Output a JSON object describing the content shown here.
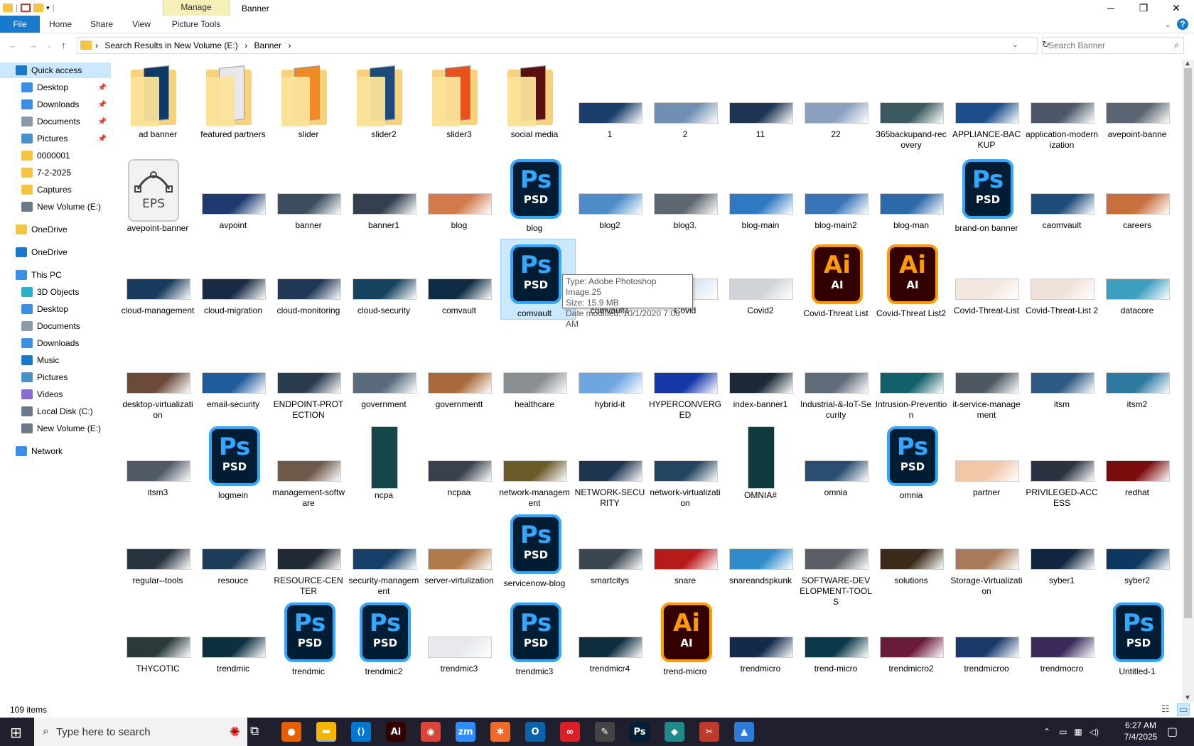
{
  "window": {
    "title": "Banner",
    "context_tab_label": "Manage",
    "minimize": "─",
    "restore": "❐",
    "close": "✕"
  },
  "ribbon": {
    "tabs": [
      "File",
      "Home",
      "Share",
      "View",
      "Picture Tools"
    ],
    "help": "?"
  },
  "address": {
    "crumbs": [
      "Search Results in New Volume (E:)",
      "Banner"
    ],
    "search_placeholder": "Search Banner"
  },
  "sidebar": {
    "items": [
      {
        "label": "Quick access",
        "icon": "star-icon",
        "pinned": false,
        "selected": true
      },
      {
        "label": "Desktop",
        "icon": "desktop-icon",
        "pinned": true
      },
      {
        "label": "Downloads",
        "icon": "download-icon",
        "pinned": true
      },
      {
        "label": "Documents",
        "icon": "documents-icon",
        "pinned": true
      },
      {
        "label": "Pictures",
        "icon": "pictures-icon",
        "pinned": true
      },
      {
        "label": "0000001",
        "icon": "folder-icon",
        "pinned": false
      },
      {
        "label": "7-2-2025",
        "icon": "folder-icon",
        "pinned": false
      },
      {
        "label": "Captures",
        "icon": "folder-icon",
        "pinned": false
      },
      {
        "label": "New Volume (E:)",
        "icon": "drive-icon",
        "pinned": false
      },
      {
        "label": "OneDrive",
        "icon": "folder-icon",
        "pinned": false
      },
      {
        "label": "OneDrive",
        "icon": "cloud-icon",
        "pinned": false
      },
      {
        "label": "This PC",
        "icon": "pc-icon",
        "pinned": false
      },
      {
        "label": "3D Objects",
        "icon": "cube-icon",
        "pinned": false
      },
      {
        "label": "Desktop",
        "icon": "desktop-icon",
        "pinned": false
      },
      {
        "label": "Documents",
        "icon": "documents-icon",
        "pinned": false
      },
      {
        "label": "Downloads",
        "icon": "download-icon",
        "pinned": false
      },
      {
        "label": "Music",
        "icon": "music-icon",
        "pinned": false
      },
      {
        "label": "Pictures",
        "icon": "pictures-icon",
        "pinned": false
      },
      {
        "label": "Videos",
        "icon": "video-icon",
        "pinned": false
      },
      {
        "label": "Local Disk (C:)",
        "icon": "drive-icon",
        "pinned": false
      },
      {
        "label": "New Volume (E:)",
        "icon": "drive-icon",
        "pinned": false
      },
      {
        "label": "Network",
        "icon": "network-icon",
        "pinned": false
      }
    ],
    "pin_glyph": "📌"
  },
  "files": [
    [
      {
        "name": "ad banner",
        "kind": "folder",
        "color": "#0d3b66"
      },
      {
        "name": "featured partners",
        "kind": "folder",
        "color": "#e8e8e8"
      },
      {
        "name": "slider",
        "kind": "folder",
        "color": "#f08a24"
      },
      {
        "name": "slider2",
        "kind": "folder",
        "color": "#1c4a7a"
      },
      {
        "name": "slider3",
        "kind": "folder",
        "color": "#e8501c"
      },
      {
        "name": "social media",
        "kind": "folder",
        "color": "#5a1010"
      },
      {
        "name": "1",
        "kind": "img",
        "color": "#1a3f6b"
      },
      {
        "name": "2",
        "kind": "img",
        "color": "#6f8fb3"
      },
      {
        "name": "11",
        "kind": "img",
        "color": "#1e3554"
      },
      {
        "name": "22",
        "kind": "img",
        "color": "#8aa0bf"
      },
      {
        "name": "365backupand-recovery",
        "kind": "img",
        "color": "#3a5a5f"
      },
      {
        "name": "APPLIANCE-BACKUP",
        "kind": "img",
        "color": "#1b4e8a"
      },
      {
        "name": "application-modernization",
        "kind": "img",
        "color": "#4c5868"
      },
      {
        "name": "avepoint-banne",
        "kind": "img",
        "color": "#5b6572"
      }
    ],
    [
      {
        "name": "avepoint-banner",
        "kind": "eps"
      },
      {
        "name": "avpoint",
        "kind": "img",
        "color": "#1e3a70"
      },
      {
        "name": "banner",
        "kind": "img",
        "color": "#3b4d5e"
      },
      {
        "name": "banner1",
        "kind": "img",
        "color": "#34404e"
      },
      {
        "name": "blog",
        "kind": "img",
        "color": "#d17b4c"
      },
      {
        "name": "blog",
        "kind": "ps"
      },
      {
        "name": "blog2",
        "kind": "img",
        "color": "#4d8cc9"
      },
      {
        "name": "blog3.",
        "kind": "img",
        "color": "#5d6770"
      },
      {
        "name": "blog-main",
        "kind": "img",
        "color": "#2f78c2"
      },
      {
        "name": "blog-main2",
        "kind": "img",
        "color": "#3773b6"
      },
      {
        "name": "blog-man",
        "kind": "img",
        "color": "#2d6aa8"
      },
      {
        "name": "brand-on banner",
        "kind": "ps"
      },
      {
        "name": "caomvault",
        "kind": "img",
        "color": "#1e4d7a"
      },
      {
        "name": "careers",
        "kind": "img",
        "color": "#c8703d"
      }
    ],
    [
      {
        "name": "cloud-management",
        "kind": "img",
        "color": "#173a5e"
      },
      {
        "name": "cloud-migration",
        "kind": "img",
        "color": "#1a2c45"
      },
      {
        "name": "cloud-monitoring",
        "kind": "img",
        "color": "#203855"
      },
      {
        "name": "cloud-security",
        "kind": "img",
        "color": "#14425f"
      },
      {
        "name": "comvault",
        "kind": "img",
        "color": "#0e2d44"
      },
      {
        "name": "comvault",
        "kind": "ps",
        "selected": true
      },
      {
        "name": "comvault1",
        "kind": "img",
        "color": "#4a6580"
      },
      {
        "name": "Covid",
        "kind": "img",
        "color": "#dbe5f2"
      },
      {
        "name": "Covid2",
        "kind": "img",
        "color": "#d0d4d8"
      },
      {
        "name": "Covid-Threat List",
        "kind": "ai"
      },
      {
        "name": "Covid-Threat List2",
        "kind": "ai"
      },
      {
        "name": "Covid-Threat-List",
        "kind": "img",
        "color": "#f2e6df"
      },
      {
        "name": "Covid-Threat-List 2",
        "kind": "img",
        "color": "#f0e2d9"
      },
      {
        "name": "datacore",
        "kind": "img",
        "color": "#3d9fbf"
      }
    ],
    [
      {
        "name": "desktop-virtualization",
        "kind": "img",
        "color": "#6b4a3a"
      },
      {
        "name": "email-security",
        "kind": "img",
        "color": "#1f5a9a"
      },
      {
        "name": "ENDPOINT-PROTECTION",
        "kind": "img",
        "color": "#2a3d4f"
      },
      {
        "name": "government",
        "kind": "img",
        "color": "#596b7d"
      },
      {
        "name": "governmentt",
        "kind": "img",
        "color": "#a86a3a"
      },
      {
        "name": "healthcare",
        "kind": "img",
        "color": "#8a8f94"
      },
      {
        "name": "hybrid-it",
        "kind": "img",
        "color": "#6fa6e0"
      },
      {
        "name": "HYPERCONVERGED",
        "kind": "img",
        "color": "#1438a8"
      },
      {
        "name": "index-banner1",
        "kind": "img",
        "color": "#1c2a38"
      },
      {
        "name": "Industrial-&-IoT-Security",
        "kind": "img",
        "color": "#5f6b78"
      },
      {
        "name": "Intrusion-Prevention",
        "kind": "img",
        "color": "#12606a"
      },
      {
        "name": "it-service-management",
        "kind": "img",
        "color": "#4c5760"
      },
      {
        "name": "itsm",
        "kind": "img",
        "color": "#2c5a82"
      },
      {
        "name": "itsm2",
        "kind": "img",
        "color": "#2e7aa0"
      }
    ],
    [
      {
        "name": "itsm3",
        "kind": "img",
        "color": "#505a66"
      },
      {
        "name": "logmein",
        "kind": "ps"
      },
      {
        "name": "management-software",
        "kind": "img",
        "color": "#6e5a4a"
      },
      {
        "name": "ncpa",
        "kind": "tall",
        "color": "#15464a"
      },
      {
        "name": "ncpaa",
        "kind": "img",
        "color": "#39424c"
      },
      {
        "name": "network-management",
        "kind": "img",
        "color": "#6a5a2a"
      },
      {
        "name": "NETWORK-SECURITY",
        "kind": "img",
        "color": "#1e3550"
      },
      {
        "name": "network-virtualization",
        "kind": "img",
        "color": "#244460"
      },
      {
        "name": "OMNIA#",
        "kind": "tall",
        "color": "#113a3e"
      },
      {
        "name": "omnia",
        "kind": "img",
        "color": "#2a4d70"
      },
      {
        "name": "omnia",
        "kind": "ps"
      },
      {
        "name": "partner",
        "kind": "img",
        "color": "#f1c7a8"
      },
      {
        "name": "PRIVILEGED-ACCESS",
        "kind": "img",
        "color": "#2b3340"
      },
      {
        "name": "redhat",
        "kind": "img",
        "color": "#7a0c0c"
      }
    ],
    [
      {
        "name": "regular--tools",
        "kind": "img",
        "color": "#27333f"
      },
      {
        "name": "resouce",
        "kind": "img",
        "color": "#1d3b5a"
      },
      {
        "name": "RESOURCE-CENTER",
        "kind": "img",
        "color": "#202a35"
      },
      {
        "name": "security-management",
        "kind": "img",
        "color": "#16406a"
      },
      {
        "name": "server-virtulization",
        "kind": "img",
        "color": "#b07a4a"
      },
      {
        "name": "servicenow-blog",
        "kind": "ps"
      },
      {
        "name": "smartcitys",
        "kind": "img",
        "color": "#3a4650"
      },
      {
        "name": "snare",
        "kind": "img",
        "color": "#b81a1a"
      },
      {
        "name": "snareandspkunk",
        "kind": "img",
        "color": "#2e8ac9"
      },
      {
        "name": "SOFTWARE-DEVELOPMENT-TOOLS",
        "kind": "img",
        "color": "#5a5f66"
      },
      {
        "name": "solutions",
        "kind": "img",
        "color": "#3a2a1a"
      },
      {
        "name": "Storage-Virtualization",
        "kind": "img",
        "color": "#a87a5a"
      },
      {
        "name": "syber1",
        "kind": "img",
        "color": "#0f2540"
      },
      {
        "name": "syber2",
        "kind": "img",
        "color": "#0e3860"
      }
    ],
    [
      {
        "name": "THYCOTIC",
        "kind": "img",
        "color": "#2a3a3a"
      },
      {
        "name": "trendmic",
        "kind": "img",
        "color": "#0c3040"
      },
      {
        "name": "trendmic",
        "kind": "ps"
      },
      {
        "name": "trendmic2",
        "kind": "ps"
      },
      {
        "name": "trendmic3",
        "kind": "img",
        "color": "#e6eaee"
      },
      {
        "name": "trendmic3",
        "kind": "ps"
      },
      {
        "name": "trendmicr4",
        "kind": "img",
        "color": "#0d2e3e"
      },
      {
        "name": "trend-micro",
        "kind": "ai"
      },
      {
        "name": "trendmicro",
        "kind": "img",
        "color": "#132a4a"
      },
      {
        "name": "trend-micro",
        "kind": "img",
        "color": "#0a3a4a"
      },
      {
        "name": "trendmicro2",
        "kind": "img",
        "color": "#6a1a3a"
      },
      {
        "name": "trendmicroo",
        "kind": "img",
        "color": "#1a3a6a"
      },
      {
        "name": "trendmocro",
        "kind": "img",
        "color": "#3a2a5a"
      },
      {
        "name": "Untitled-1",
        "kind": "ps"
      }
    ]
  ],
  "icons": {
    "ps_big": "Ps",
    "ps_small": "PSD",
    "ai_big": "Ai",
    "ai_small": "AI",
    "eps_label": "EPS"
  },
  "tooltip": {
    "line1": "Type: Adobe Photoshop Image.25",
    "line2": "Size: 15.9 MB",
    "line3": "Date modified: 10/1/2020 7:08 AM"
  },
  "status": {
    "count": "109 items"
  },
  "taskbar": {
    "search_placeholder": "Type here to search",
    "apps": [
      {
        "icon": "firefox-icon",
        "glyph": "●",
        "color": "#e66000"
      },
      {
        "icon": "file-explorer-icon",
        "glyph": "▬",
        "color": "#f4b400",
        "active": true
      },
      {
        "icon": "vscode-icon",
        "glyph": "⟨⟩",
        "color": "#0078d4"
      },
      {
        "icon": "illustrator-icon",
        "glyph": "Ai",
        "color": "#330000"
      },
      {
        "icon": "chrome-icon",
        "glyph": "◉",
        "color": "#db4437"
      },
      {
        "icon": "zoom-icon",
        "glyph": "zm",
        "color": "#2d8cff"
      },
      {
        "icon": "postman-icon",
        "glyph": "✱",
        "color": "#f06a2a"
      },
      {
        "icon": "outlook-icon",
        "glyph": "O",
        "color": "#0a64ad"
      },
      {
        "icon": "creative-cloud-icon",
        "glyph": "∞",
        "color": "#da1f26"
      },
      {
        "icon": "pen-icon",
        "glyph": "✎",
        "color": "#444444"
      },
      {
        "icon": "photoshop-icon",
        "glyph": "Ps",
        "color": "#001e36"
      },
      {
        "icon": "app-icon",
        "glyph": "◆",
        "color": "#1f8a8a"
      },
      {
        "icon": "snipping-icon",
        "glyph": "✂",
        "color": "#c0392b"
      },
      {
        "icon": "photos-icon",
        "glyph": "▲",
        "color": "#2f7bd8"
      }
    ],
    "time": "6:27 AM",
    "date": "7/4/2025"
  }
}
